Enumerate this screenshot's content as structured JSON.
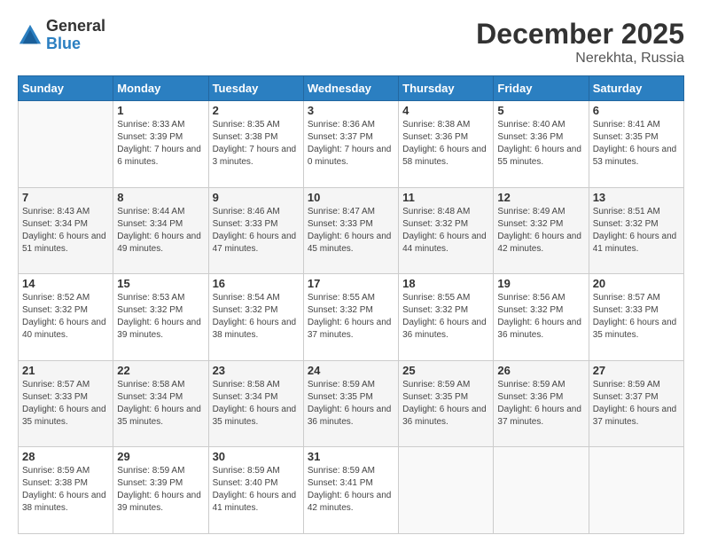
{
  "logo": {
    "general": "General",
    "blue": "Blue"
  },
  "header": {
    "month": "December 2025",
    "location": "Nerekhta, Russia"
  },
  "weekdays": [
    "Sunday",
    "Monday",
    "Tuesday",
    "Wednesday",
    "Thursday",
    "Friday",
    "Saturday"
  ],
  "weeks": [
    [
      {
        "day": "",
        "sunrise": "",
        "sunset": "",
        "daylight": ""
      },
      {
        "day": "1",
        "sunrise": "Sunrise: 8:33 AM",
        "sunset": "Sunset: 3:39 PM",
        "daylight": "Daylight: 7 hours and 6 minutes."
      },
      {
        "day": "2",
        "sunrise": "Sunrise: 8:35 AM",
        "sunset": "Sunset: 3:38 PM",
        "daylight": "Daylight: 7 hours and 3 minutes."
      },
      {
        "day": "3",
        "sunrise": "Sunrise: 8:36 AM",
        "sunset": "Sunset: 3:37 PM",
        "daylight": "Daylight: 7 hours and 0 minutes."
      },
      {
        "day": "4",
        "sunrise": "Sunrise: 8:38 AM",
        "sunset": "Sunset: 3:36 PM",
        "daylight": "Daylight: 6 hours and 58 minutes."
      },
      {
        "day": "5",
        "sunrise": "Sunrise: 8:40 AM",
        "sunset": "Sunset: 3:36 PM",
        "daylight": "Daylight: 6 hours and 55 minutes."
      },
      {
        "day": "6",
        "sunrise": "Sunrise: 8:41 AM",
        "sunset": "Sunset: 3:35 PM",
        "daylight": "Daylight: 6 hours and 53 minutes."
      }
    ],
    [
      {
        "day": "7",
        "sunrise": "Sunrise: 8:43 AM",
        "sunset": "Sunset: 3:34 PM",
        "daylight": "Daylight: 6 hours and 51 minutes."
      },
      {
        "day": "8",
        "sunrise": "Sunrise: 8:44 AM",
        "sunset": "Sunset: 3:34 PM",
        "daylight": "Daylight: 6 hours and 49 minutes."
      },
      {
        "day": "9",
        "sunrise": "Sunrise: 8:46 AM",
        "sunset": "Sunset: 3:33 PM",
        "daylight": "Daylight: 6 hours and 47 minutes."
      },
      {
        "day": "10",
        "sunrise": "Sunrise: 8:47 AM",
        "sunset": "Sunset: 3:33 PM",
        "daylight": "Daylight: 6 hours and 45 minutes."
      },
      {
        "day": "11",
        "sunrise": "Sunrise: 8:48 AM",
        "sunset": "Sunset: 3:32 PM",
        "daylight": "Daylight: 6 hours and 44 minutes."
      },
      {
        "day": "12",
        "sunrise": "Sunrise: 8:49 AM",
        "sunset": "Sunset: 3:32 PM",
        "daylight": "Daylight: 6 hours and 42 minutes."
      },
      {
        "day": "13",
        "sunrise": "Sunrise: 8:51 AM",
        "sunset": "Sunset: 3:32 PM",
        "daylight": "Daylight: 6 hours and 41 minutes."
      }
    ],
    [
      {
        "day": "14",
        "sunrise": "Sunrise: 8:52 AM",
        "sunset": "Sunset: 3:32 PM",
        "daylight": "Daylight: 6 hours and 40 minutes."
      },
      {
        "day": "15",
        "sunrise": "Sunrise: 8:53 AM",
        "sunset": "Sunset: 3:32 PM",
        "daylight": "Daylight: 6 hours and 39 minutes."
      },
      {
        "day": "16",
        "sunrise": "Sunrise: 8:54 AM",
        "sunset": "Sunset: 3:32 PM",
        "daylight": "Daylight: 6 hours and 38 minutes."
      },
      {
        "day": "17",
        "sunrise": "Sunrise: 8:55 AM",
        "sunset": "Sunset: 3:32 PM",
        "daylight": "Daylight: 6 hours and 37 minutes."
      },
      {
        "day": "18",
        "sunrise": "Sunrise: 8:55 AM",
        "sunset": "Sunset: 3:32 PM",
        "daylight": "Daylight: 6 hours and 36 minutes."
      },
      {
        "day": "19",
        "sunrise": "Sunrise: 8:56 AM",
        "sunset": "Sunset: 3:32 PM",
        "daylight": "Daylight: 6 hours and 36 minutes."
      },
      {
        "day": "20",
        "sunrise": "Sunrise: 8:57 AM",
        "sunset": "Sunset: 3:33 PM",
        "daylight": "Daylight: 6 hours and 35 minutes."
      }
    ],
    [
      {
        "day": "21",
        "sunrise": "Sunrise: 8:57 AM",
        "sunset": "Sunset: 3:33 PM",
        "daylight": "Daylight: 6 hours and 35 minutes."
      },
      {
        "day": "22",
        "sunrise": "Sunrise: 8:58 AM",
        "sunset": "Sunset: 3:34 PM",
        "daylight": "Daylight: 6 hours and 35 minutes."
      },
      {
        "day": "23",
        "sunrise": "Sunrise: 8:58 AM",
        "sunset": "Sunset: 3:34 PM",
        "daylight": "Daylight: 6 hours and 35 minutes."
      },
      {
        "day": "24",
        "sunrise": "Sunrise: 8:59 AM",
        "sunset": "Sunset: 3:35 PM",
        "daylight": "Daylight: 6 hours and 36 minutes."
      },
      {
        "day": "25",
        "sunrise": "Sunrise: 8:59 AM",
        "sunset": "Sunset: 3:35 PM",
        "daylight": "Daylight: 6 hours and 36 minutes."
      },
      {
        "day": "26",
        "sunrise": "Sunrise: 8:59 AM",
        "sunset": "Sunset: 3:36 PM",
        "daylight": "Daylight: 6 hours and 37 minutes."
      },
      {
        "day": "27",
        "sunrise": "Sunrise: 8:59 AM",
        "sunset": "Sunset: 3:37 PM",
        "daylight": "Daylight: 6 hours and 37 minutes."
      }
    ],
    [
      {
        "day": "28",
        "sunrise": "Sunrise: 8:59 AM",
        "sunset": "Sunset: 3:38 PM",
        "daylight": "Daylight: 6 hours and 38 minutes."
      },
      {
        "day": "29",
        "sunrise": "Sunrise: 8:59 AM",
        "sunset": "Sunset: 3:39 PM",
        "daylight": "Daylight: 6 hours and 39 minutes."
      },
      {
        "day": "30",
        "sunrise": "Sunrise: 8:59 AM",
        "sunset": "Sunset: 3:40 PM",
        "daylight": "Daylight: 6 hours and 41 minutes."
      },
      {
        "day": "31",
        "sunrise": "Sunrise: 8:59 AM",
        "sunset": "Sunset: 3:41 PM",
        "daylight": "Daylight: 6 hours and 42 minutes."
      },
      {
        "day": "",
        "sunrise": "",
        "sunset": "",
        "daylight": ""
      },
      {
        "day": "",
        "sunrise": "",
        "sunset": "",
        "daylight": ""
      },
      {
        "day": "",
        "sunrise": "",
        "sunset": "",
        "daylight": ""
      }
    ]
  ]
}
